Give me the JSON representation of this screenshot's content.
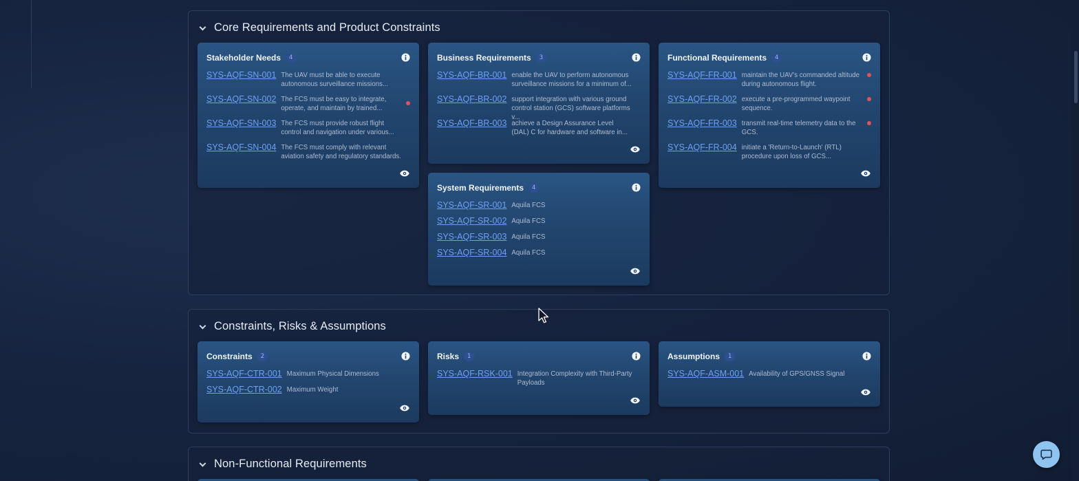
{
  "sections": [
    {
      "title": "Core Requirements and Product Constraints",
      "cards": [
        {
          "title": "Stakeholder Needs",
          "count": "4",
          "items": [
            {
              "id": "SYS-AQF-SN-001",
              "text": "The UAV must be able to execute autonomous surveillance missions...",
              "flag": false
            },
            {
              "id": "SYS-AQF-SN-002",
              "text": "The FCS must be easy to integrate, operate, and maintain by trained...",
              "flag": true
            },
            {
              "id": "SYS-AQF-SN-003",
              "text": "The FCS must provide robust flight control and navigation under various...",
              "flag": false
            },
            {
              "id": "SYS-AQF-SN-004",
              "text": "The FCS must comply with relevant aviation safety and regulatory standards.",
              "flag": false
            }
          ]
        },
        {
          "title": "Business Requirements",
          "count": "3",
          "items": [
            {
              "id": "SYS-AQF-BR-001",
              "text": "enable the UAV to perform autonomous surveillance missions for a minimum of...",
              "flag": false
            },
            {
              "id": "SYS-AQF-BR-002",
              "text": "support integration with various ground control station (GCS) software platforms v...",
              "flag": false
            },
            {
              "id": "SYS-AQF-BR-003",
              "text": "achieve a Design Assurance Level (DAL) C for hardware and software in...",
              "flag": false
            }
          ]
        },
        {
          "title": "Functional Requirements",
          "count": "4",
          "items": [
            {
              "id": "SYS-AQF-FR-001",
              "text": "maintain the UAV's commanded altitude during autonomous flight.",
              "flag": true
            },
            {
              "id": "SYS-AQF-FR-002",
              "text": "execute a pre-programmed waypoint sequence.",
              "flag": true
            },
            {
              "id": "SYS-AQF-FR-003",
              "text": "transmit real-time telemetry data to the GCS.",
              "flag": true
            },
            {
              "id": "SYS-AQF-FR-004",
              "text": "initiate a 'Return-to-Launch' (RTL) procedure upon loss of GCS...",
              "flag": false
            }
          ]
        },
        {
          "title": "System Requirements",
          "count": "4",
          "items": [
            {
              "id": "SYS-AQF-SR-001",
              "text": "Aquila FCS",
              "flag": false
            },
            {
              "id": "SYS-AQF-SR-002",
              "text": "Aquila FCS",
              "flag": false
            },
            {
              "id": "SYS-AQF-SR-003",
              "text": "Aquila FCS",
              "flag": false
            },
            {
              "id": "SYS-AQF-SR-004",
              "text": "Aquila FCS",
              "flag": false
            }
          ]
        }
      ]
    },
    {
      "title": "Constraints, Risks & Assumptions",
      "cards": [
        {
          "title": "Constraints",
          "count": "2",
          "items": [
            {
              "id": "SYS-AQF-CTR-001",
              "text": "Maximum Physical Dimensions",
              "flag": false
            },
            {
              "id": "SYS-AQF-CTR-002",
              "text": "Maximum Weight",
              "flag": false
            }
          ]
        },
        {
          "title": "Risks",
          "count": "1",
          "items": [
            {
              "id": "SYS-AQF-RSK-001",
              "text": "Integration Complexity with Third-Party Payloads",
              "flag": false
            }
          ]
        },
        {
          "title": "Assumptions",
          "count": "1",
          "items": [
            {
              "id": "SYS-AQF-ASM-001",
              "text": "Availability of GPS/GNSS Signal",
              "flag": false
            }
          ]
        }
      ]
    },
    {
      "title": "Non-Functional Requirements",
      "cards": []
    }
  ],
  "icons": {
    "section_toggle": "chevron-down-icon",
    "card_info": "info-icon",
    "card_view": "eye-icon",
    "chat": "chat-bubble-icon"
  },
  "colors": {
    "link": "#6fa0f4",
    "flag": "#e0525c",
    "card_top": "#2a5584",
    "card_bottom": "#1c3a5f",
    "chat_button": "#8fc4f0"
  }
}
